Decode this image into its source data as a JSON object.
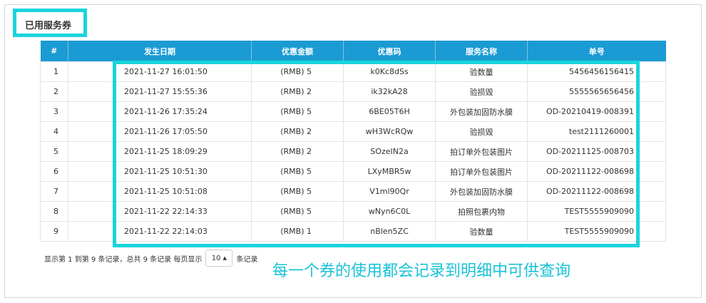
{
  "panel": {
    "title": "已用服务券"
  },
  "table": {
    "headers": [
      "#",
      "发生日期",
      "优惠金额",
      "优惠码",
      "服务名称",
      "单号"
    ],
    "rows": [
      [
        "1",
        "2021-11-27 16:01:50",
        "(RMB) 5",
        "k0Kc8dSs",
        "验数量",
        "5456456156415"
      ],
      [
        "2",
        "2021-11-27 15:55:36",
        "(RMB) 2",
        "ik32kA28",
        "验损毁",
        "5555565656456"
      ],
      [
        "3",
        "2021-11-26 17:35:24",
        "(RMB) 5",
        "6BE05T6H",
        "外包装加固防水膜",
        "OD-20210419-008391"
      ],
      [
        "4",
        "2021-11-26 17:05:50",
        "(RMB) 2",
        "wH3WcRQw",
        "验损毁",
        "test2111260001"
      ],
      [
        "5",
        "2021-11-25 18:09:29",
        "(RMB) 2",
        "SOzeIN2a",
        "拍订单外包装图片",
        "OD-20211125-008703"
      ],
      [
        "6",
        "2021-11-25 10:51:30",
        "(RMB) 5",
        "LXyMBR5w",
        "拍订单外包装图片",
        "OD-20211122-008698"
      ],
      [
        "7",
        "2021-11-25 10:51:08",
        "(RMB) 5",
        "V1ml90Qr",
        "外包装加固防水膜",
        "OD-20211122-008698"
      ],
      [
        "8",
        "2021-11-22 22:14:33",
        "(RMB) 5",
        "wNyn6C0L",
        "拍照包裹内物",
        "TEST5555909090"
      ],
      [
        "9",
        "2021-11-22 22:14:03",
        "(RMB) 1",
        "nBlen5ZC",
        "验数量",
        "TEST5555909090"
      ]
    ]
  },
  "pager": {
    "summary": "显示第 1 到第 9 条记录，总共 9 条记录 每页显示",
    "page_size": "10",
    "suffix": "条记录"
  },
  "annotation": "每一个券的使用都会记录到明细中可供查询",
  "colors": {
    "accent": "#19d4dc",
    "header_bg": "#1b9bd3",
    "annotation_text": "#19c2d6"
  }
}
